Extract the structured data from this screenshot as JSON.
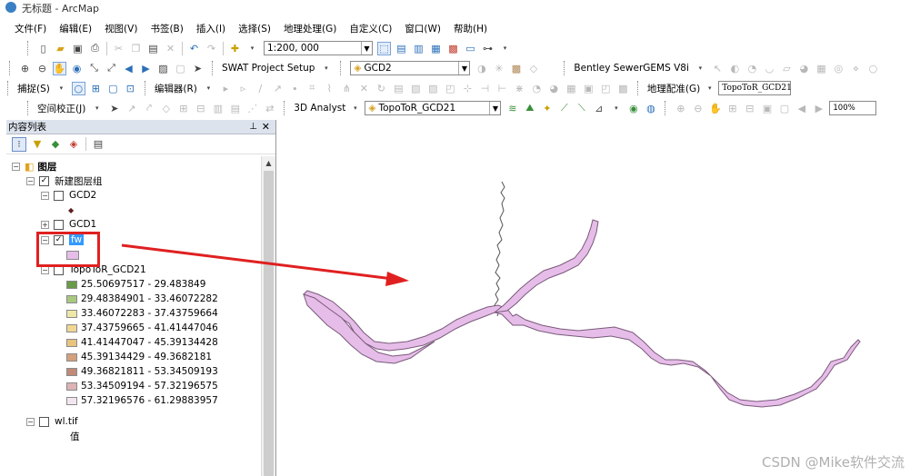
{
  "app": {
    "title": "无标题 - ArcMap"
  },
  "menubar": [
    "文件(F)",
    "编辑(E)",
    "视图(V)",
    "书签(B)",
    "插入(I)",
    "选择(S)",
    "地理处理(G)",
    "自定义(C)",
    "窗口(W)",
    "帮助(H)"
  ],
  "toolbar1": {
    "scale": "1:200, 000"
  },
  "toolbar2": {
    "swat_label": "SWAT Project Setup",
    "layer_combo": "GCD2",
    "bentley_label": "Bentley SewerGEMS V8i"
  },
  "toolbar3": {
    "snap_label": "捕捉(S)",
    "editor_label": "编辑器(R)",
    "georef_label": "地理配准(G)",
    "georef_layer": "TopoToR_GCD21"
  },
  "toolbar4": {
    "spatial_adj_label": "空间校正(J)",
    "analyst_label": "3D Analyst",
    "analyst_layer": "TopoToR_GCD21",
    "zoom": "100%"
  },
  "toc": {
    "title": "内容列表",
    "root_label": "图层",
    "group_label": "新建图层组",
    "layers": {
      "gcd2": "GCD2",
      "gcd1": "GCD1",
      "fw": "fw",
      "topo": "TopoToR_GCD21",
      "wl": "wl.tif"
    },
    "wl_legend": "值",
    "legend": [
      {
        "label": "25.50697517 - 29.483849",
        "color": "#6a9a4a"
      },
      {
        "label": "29.48384901 - 33.46072282",
        "color": "#a8c880"
      },
      {
        "label": "33.46072283 - 37.43759664",
        "color": "#eee7a8"
      },
      {
        "label": "37.43759665 - 41.41447046",
        "color": "#f0d894"
      },
      {
        "label": "41.41447047 - 45.39134428",
        "color": "#e8c47c"
      },
      {
        "label": "45.39134429 - 49.3682181",
        "color": "#d4a07c"
      },
      {
        "label": "49.36821811 - 53.34509193",
        "color": "#c08a78"
      },
      {
        "label": "53.34509194 - 57.32196575",
        "color": "#dcb4b4"
      },
      {
        "label": "57.32196576 - 61.29883957",
        "color": "#f2e6f0"
      }
    ]
  },
  "colors": {
    "river_fill": "#e6bde9",
    "river_stroke": "#7a5a7a",
    "highlight": "#e02020"
  },
  "watermark": "CSDN @Mike软件交流"
}
